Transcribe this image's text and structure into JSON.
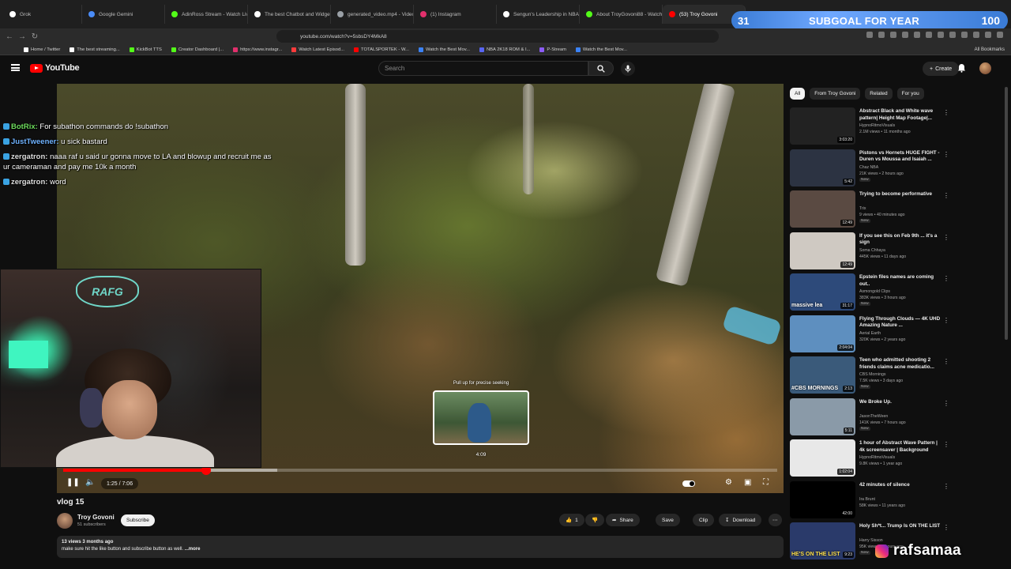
{
  "browser": {
    "tabs": [
      {
        "label": "Grok",
        "color": "#ffffff"
      },
      {
        "label": "Google Gemini",
        "color": "#4a8cf7"
      },
      {
        "label": "AdinRoss Stream - Watch Live",
        "color": "#53fc18"
      },
      {
        "label": "The best Chatbot and Widget...",
        "color": "#ffffff"
      },
      {
        "label": "generated_video.mp4 - Video",
        "color": "#9aa0a6"
      },
      {
        "label": "(1) Instagram",
        "color": "#e1306c"
      },
      {
        "label": "Sengun's Leadership in NBA...",
        "color": "#ffffff"
      },
      {
        "label": "About TroyGovoni88 - Watch...",
        "color": "#53fc18"
      },
      {
        "label": "(53) Troy Govoni",
        "color": "#ff0000"
      }
    ],
    "url": "youtube.com/watch?v=5sbsDY4MkA8",
    "bookmarks": [
      {
        "label": "Home / Twitter",
        "color": "#ffffff"
      },
      {
        "label": "The best streaming...",
        "color": "#ffffff"
      },
      {
        "label": "KickBot TTS",
        "color": "#53fc18"
      },
      {
        "label": "Creator Dashboard |...",
        "color": "#53fc18"
      },
      {
        "label": "https://www.instagr...",
        "color": "#e1306c"
      },
      {
        "label": "Watch Latest Episod...",
        "color": "#ff3b3b"
      },
      {
        "label": "TOTALSPORTEK - W...",
        "color": "#ff0000"
      },
      {
        "label": "Watch the Best Mov...",
        "color": "#3b82f6"
      },
      {
        "label": "NBA 2K18 ROM & I...",
        "color": "#5865f2"
      },
      {
        "label": "P-Stream",
        "color": "#8b5cf6"
      },
      {
        "label": "Watch the Best Mov...",
        "color": "#3b82f6"
      }
    ],
    "all_bookmarks": "All Bookmarks"
  },
  "overlay": {
    "subgoal_count": "31",
    "subgoal_label": "SUBGOAL FOR YEAR",
    "subgoal_target": "100",
    "watermark": "rafsamaa"
  },
  "chat": [
    {
      "user": "BotRix:",
      "text": " For subathon commands do !subathon",
      "style": "u1"
    },
    {
      "user": "JustTweener:",
      "text": " u sick bastard",
      "style": "u2"
    },
    {
      "user": "zergatron:",
      "text": " naaa raf u said ur gonna move to LA and blowup and recruit me as ur cameraman and pay me 10k a month",
      "style": "u3"
    },
    {
      "user": "zergatron:",
      "text": " word",
      "style": "u3"
    }
  ],
  "youtube": {
    "logo": "YouTube",
    "search_placeholder": "Search",
    "create": "Create"
  },
  "player": {
    "time": "1:25 / 7:06",
    "progress_fraction": 0.2,
    "buffered_fraction": 0.3,
    "preview_hint": "Pull up for precise seeking",
    "preview_time": "4:09",
    "preview_fraction": 0.585
  },
  "video": {
    "title": "vlog 15",
    "channel": "Troy Govoni",
    "subscribers": "51 subscribers",
    "subscribe": "Subscribe",
    "likes": "1",
    "share": "Share",
    "save": "Save",
    "clip": "Clip",
    "download": "Download",
    "views_date": "13 views  3 months ago",
    "description": "make sure hit the like button and subscribe button as well. ",
    "more": "...more"
  },
  "sidebar": {
    "chips": [
      "All",
      "From Troy Govoni",
      "Related",
      "For you"
    ],
    "recs": [
      {
        "title": "Abstract Black and White wave pattern| Height Map Footage|...",
        "channel": "HypnoRitmoVisuals",
        "stats": "2.1M views • 11 months ago",
        "duration": "3:03:20",
        "new": "",
        "thumb": "#222"
      },
      {
        "title": "Pistons vs Hornets HUGE FIGHT - Duren vs Moussa and Isaiah ...",
        "channel": "Chaz NBA",
        "stats": "21K views • 2 hours ago",
        "duration": "5:42",
        "new": "New",
        "thumb": "#2c3342"
      },
      {
        "title": "Trying to become performative",
        "channel": "Trix",
        "stats": "9 views • 40 minutes ago",
        "duration": "12:49",
        "new": "New",
        "thumb": "#5a4a42"
      },
      {
        "title": "If you see this on Feb 9th ... it's a sign",
        "channel": "Soma Chhaya",
        "stats": "445K views • 11 days ago",
        "duration": "12:49",
        "new": "",
        "thumb": "#cfc9c2"
      },
      {
        "title": "Epstein files names are coming out..",
        "channel": "Asmongold Clips",
        "stats": "383K views • 3 hours ago",
        "duration": "31:17",
        "new": "New",
        "thumb": "#2d4a7a"
      },
      {
        "title": "Flying Through Clouds — 4K UHD Amazing Nature ...",
        "channel": "Aerial Earth",
        "stats": "320K views • 2 years ago",
        "duration": "2:04:04",
        "new": "",
        "thumb": "#5e8fbf"
      },
      {
        "title": "Teen who admitted shooting 2 friends claims acne medicatio...",
        "channel": "CBS Mornings",
        "stats": "7.5K views • 3 days ago",
        "duration": "2:13",
        "new": "New",
        "thumb": "#3a5a7a"
      },
      {
        "title": "We Broke Up.",
        "channel": "JasonTheWeen",
        "stats": "141K views • 7 hours ago",
        "duration": "5:11",
        "new": "New",
        "thumb": "#8a9aa8"
      },
      {
        "title": "1 hour of Abstract Wave Pattern | 4k screensaver | Background",
        "channel": "HypnoRitmoVisuals",
        "stats": "9.8K views • 1 year ago",
        "duration": "1:02:04",
        "new": "",
        "thumb": "#e8e8e8"
      },
      {
        "title": "42 minutes of silence",
        "channel": "Ira Brunt",
        "stats": "58K views • 11 years ago",
        "duration": "42:00",
        "new": "",
        "thumb": "#000000"
      },
      {
        "title": "Holy Sh*t... Trump Is ON THE LIST",
        "channel": "Harry Sisson",
        "stats": "95K views • 2 hours ago",
        "duration": "9:23",
        "new": "New",
        "thumb": "#2a3a6a"
      }
    ]
  },
  "thumb_captions": {
    "epstein": "massive lea",
    "cbs": "#CBS MORNINGS",
    "trump": "HE'S ON THE LIST"
  }
}
